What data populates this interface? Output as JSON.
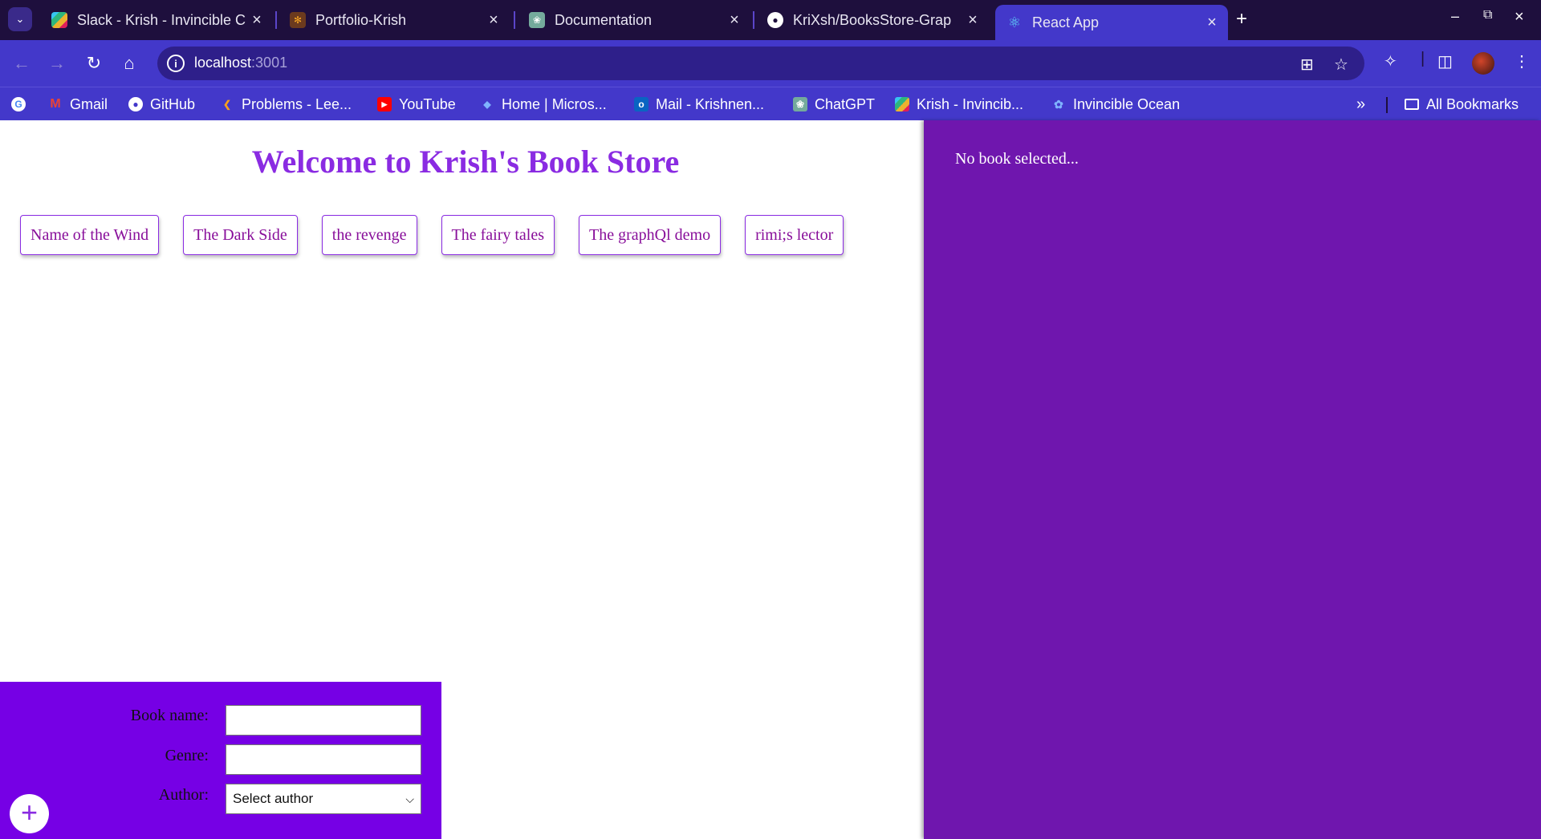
{
  "browser": {
    "tabs": [
      {
        "title": "Slack - Krish - Invincible C",
        "icon": "slack-icon"
      },
      {
        "title": "Portfolio-Krish",
        "icon": "portfolio-icon"
      },
      {
        "title": "Documentation",
        "icon": "chatgpt-icon"
      },
      {
        "title": "KriXsh/BooksStore-Grap",
        "icon": "github-icon"
      },
      {
        "title": "React App",
        "icon": "react-icon",
        "active": true
      }
    ],
    "address": {
      "host": "localhost",
      "port": ":3001"
    },
    "bookmarks": [
      {
        "label": "Gmail",
        "icon": "gmail-icon"
      },
      {
        "label": "GitHub",
        "icon": "github-icon"
      },
      {
        "label": "Problems - Lee...",
        "icon": "leetcode-icon"
      },
      {
        "label": "YouTube",
        "icon": "youtube-icon"
      },
      {
        "label": "Home | Micros...",
        "icon": "microsoft-icon"
      },
      {
        "label": "Mail - Krishnen...",
        "icon": "outlook-icon"
      },
      {
        "label": "ChatGPT",
        "icon": "chatgpt-icon"
      },
      {
        "label": "Krish - Invincib...",
        "icon": "slack-icon"
      },
      {
        "label": "Invincible Ocean",
        "icon": "ocean-icon"
      }
    ],
    "all_bookmarks": "All Bookmarks"
  },
  "page": {
    "title": "Welcome to Krish's Book Store",
    "books": [
      "Name of the Wind",
      "The Dark Side",
      "the revenge",
      "The fairy tales",
      "The graphQl demo",
      "rimi;s lector"
    ],
    "details_message": "No book selected...",
    "form": {
      "book_name_label": "Book name:",
      "genre_label": "Genre:",
      "author_label": "Author:",
      "author_selected": "Select author",
      "add_symbol": "+"
    }
  },
  "colors": {
    "accent": "#8a2be2",
    "sidebar": "#6f16ae",
    "form": "#7600e5",
    "chrome": "#4338ca"
  }
}
